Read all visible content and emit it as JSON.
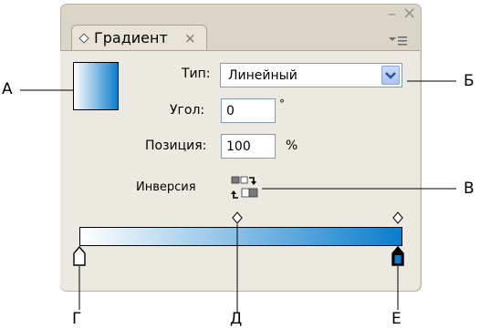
{
  "panel": {
    "tab_title": "Градиент",
    "tab_close": "×",
    "window_minimize": "–",
    "window_close": "×"
  },
  "gradient": {
    "type_label": "Тип:",
    "type_value": "Линейный",
    "angle_label": "Угол:",
    "angle_value": "0",
    "angle_unit": "°",
    "position_label": "Позиция:",
    "position_value": "100",
    "position_unit": "%",
    "reverse_label": "Инверсия",
    "start_color": "#ffffff",
    "end_color": "#0a7dcc"
  },
  "callouts": {
    "a": "А",
    "b": "Б",
    "v": "В",
    "g": "Г",
    "d": "Д",
    "e": "Е"
  },
  "icons": {
    "swatch": "gradient-swatch",
    "dropdown": "chevron-down-icon",
    "reverse": "reverse-gradient-icon",
    "panel_menu": "panel-menu-icon",
    "stop_start": "color-stop-icon",
    "stop_end": "color-stop-icon",
    "midpoint": "midpoint-diamond-icon"
  }
}
